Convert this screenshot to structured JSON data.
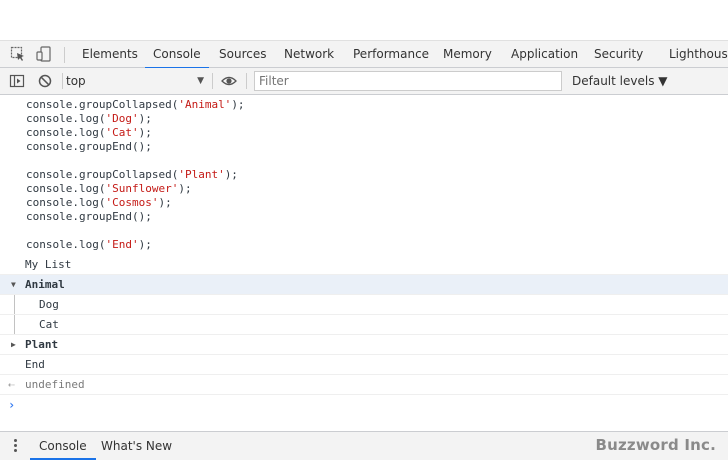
{
  "tabs": [
    "Elements",
    "Console",
    "Sources",
    "Network",
    "Performance",
    "Memory",
    "Application",
    "Security",
    "Lighthouse"
  ],
  "active_tab": "Console",
  "toolbar": {
    "context": "top",
    "filter_placeholder": "Filter",
    "levels": "Default levels"
  },
  "code": {
    "l1a": "console.groupCollapsed(",
    "l1s": "'Animal'",
    "l1b": ");",
    "l2a": "console.log(",
    "l2s": "'Dog'",
    "l2b": ");",
    "l3a": "console.log(",
    "l3s": "'Cat'",
    "l3b": ");",
    "l4": "console.groupEnd();",
    "l6a": "console.groupCollapsed(",
    "l6s": "'Plant'",
    "l6b": ");",
    "l7a": "console.log(",
    "l7s": "'Sunflower'",
    "l7b": ");",
    "l8a": "console.log(",
    "l8s": "'Cosmos'",
    "l8b": ");",
    "l9": "console.groupEnd();",
    "l11a": "console.log(",
    "l11s": "'End'",
    "l11b": ");"
  },
  "output": {
    "my_list": "My List",
    "group_animal": "Animal",
    "dog": "Dog",
    "cat": "Cat",
    "group_plant": "Plant",
    "end": "End",
    "return_value": "undefined"
  },
  "drawer": {
    "tabs": [
      "Console",
      "What's New"
    ]
  },
  "brand": "Buzzword Inc."
}
